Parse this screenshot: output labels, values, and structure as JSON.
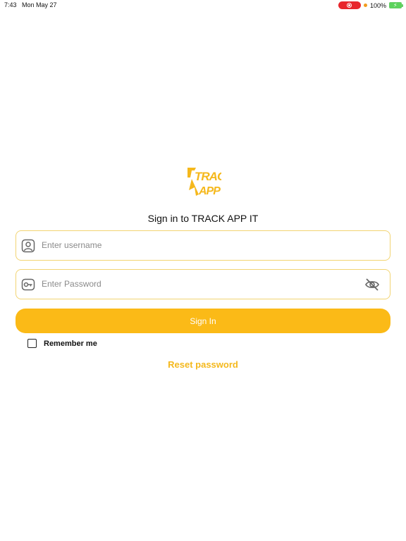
{
  "status_bar": {
    "time": "7:43",
    "date": "Mon May 27",
    "battery": "100%"
  },
  "logo": {
    "line1": "TRACK",
    "line2": "APP IT"
  },
  "login": {
    "title": "Sign in to TRACK APP IT",
    "username_placeholder": "Enter username",
    "username_value": "",
    "password_placeholder": "Enter Password",
    "password_value": "",
    "signin_label": "Sign In",
    "remember_label": "Remember me",
    "remember_checked": false,
    "reset_label": "Reset password"
  },
  "colors": {
    "accent": "#fbba17",
    "field_border": "#f2d472",
    "link": "#f4b81c",
    "record": "#e8262c"
  },
  "icons": {
    "username": "user-icon",
    "password": "key-icon",
    "visibility": "eye-off-icon"
  }
}
